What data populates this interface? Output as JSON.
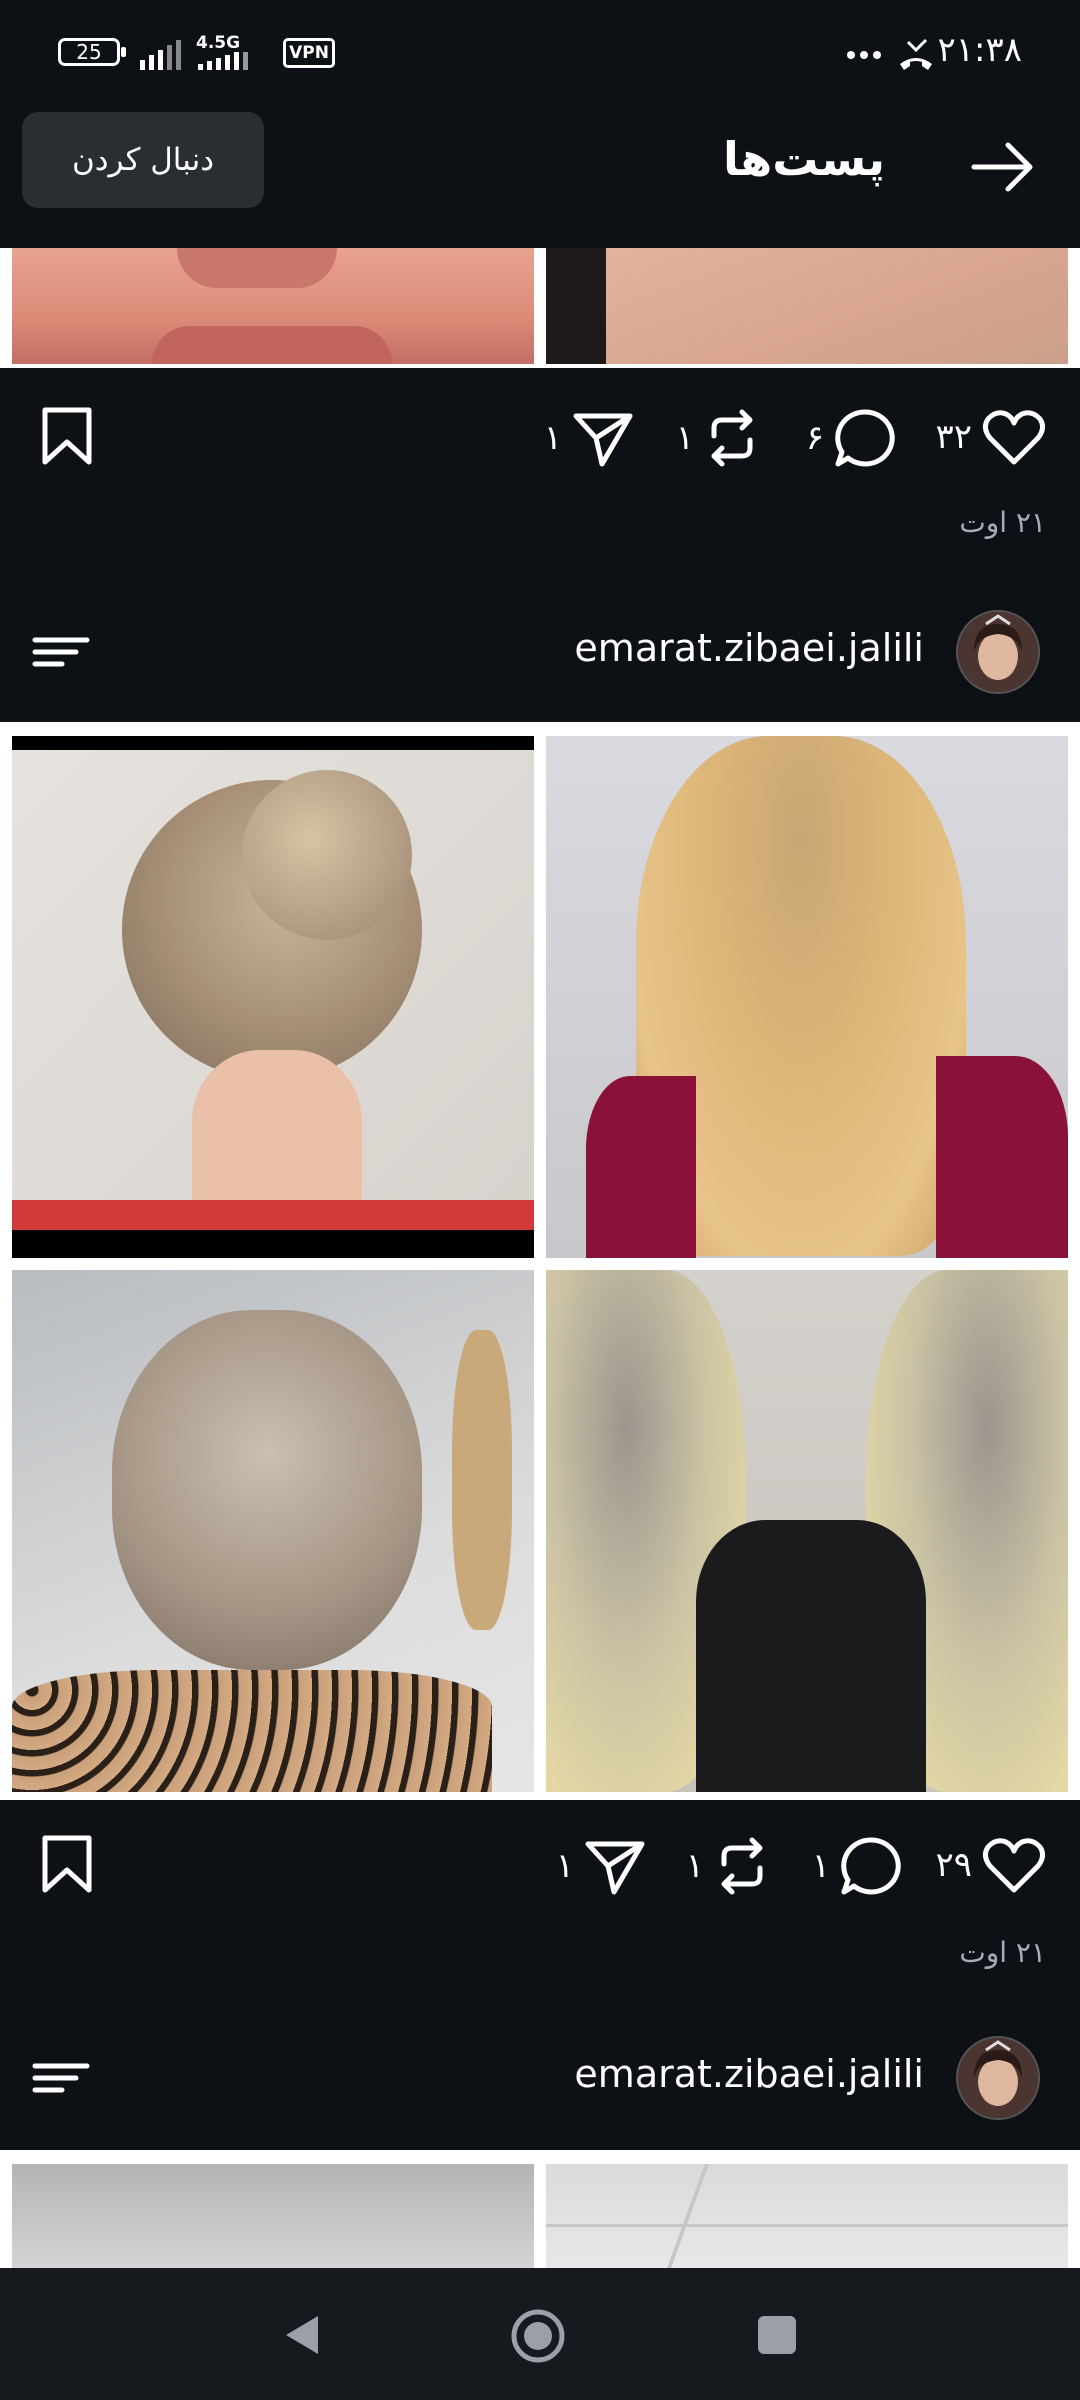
{
  "status_bar": {
    "time": "۲۱:۳۸",
    "battery": "25",
    "network": "4.5G",
    "vpn": "VPN",
    "icons": [
      "more-dots-icon",
      "missed-call-icon",
      "signal-icon",
      "battery-icon"
    ]
  },
  "header": {
    "title": "پست‌ها",
    "follow_label": "دنبال کردن",
    "back_icon": "arrow-right-icon"
  },
  "posts": [
    {
      "likes": "۳۲",
      "comments": "۶",
      "reposts": "۱",
      "shares": "۱",
      "date": "۲۱ اوت"
    },
    {
      "username": "emarat.zibaei.jalili",
      "likes": "۲۹",
      "comments": "۱",
      "reposts": "۱",
      "shares": "۱",
      "date": "۲۱ اوت"
    },
    {
      "username": "emarat.zibaei.jalili"
    }
  ],
  "nav": {
    "icons": [
      "back-triangle-icon",
      "home-circle-icon",
      "recents-square-icon"
    ]
  },
  "colors": {
    "background": "#0d1014",
    "text": "#ffffff",
    "muted": "#a8adb3",
    "button": "#2a2e33"
  }
}
